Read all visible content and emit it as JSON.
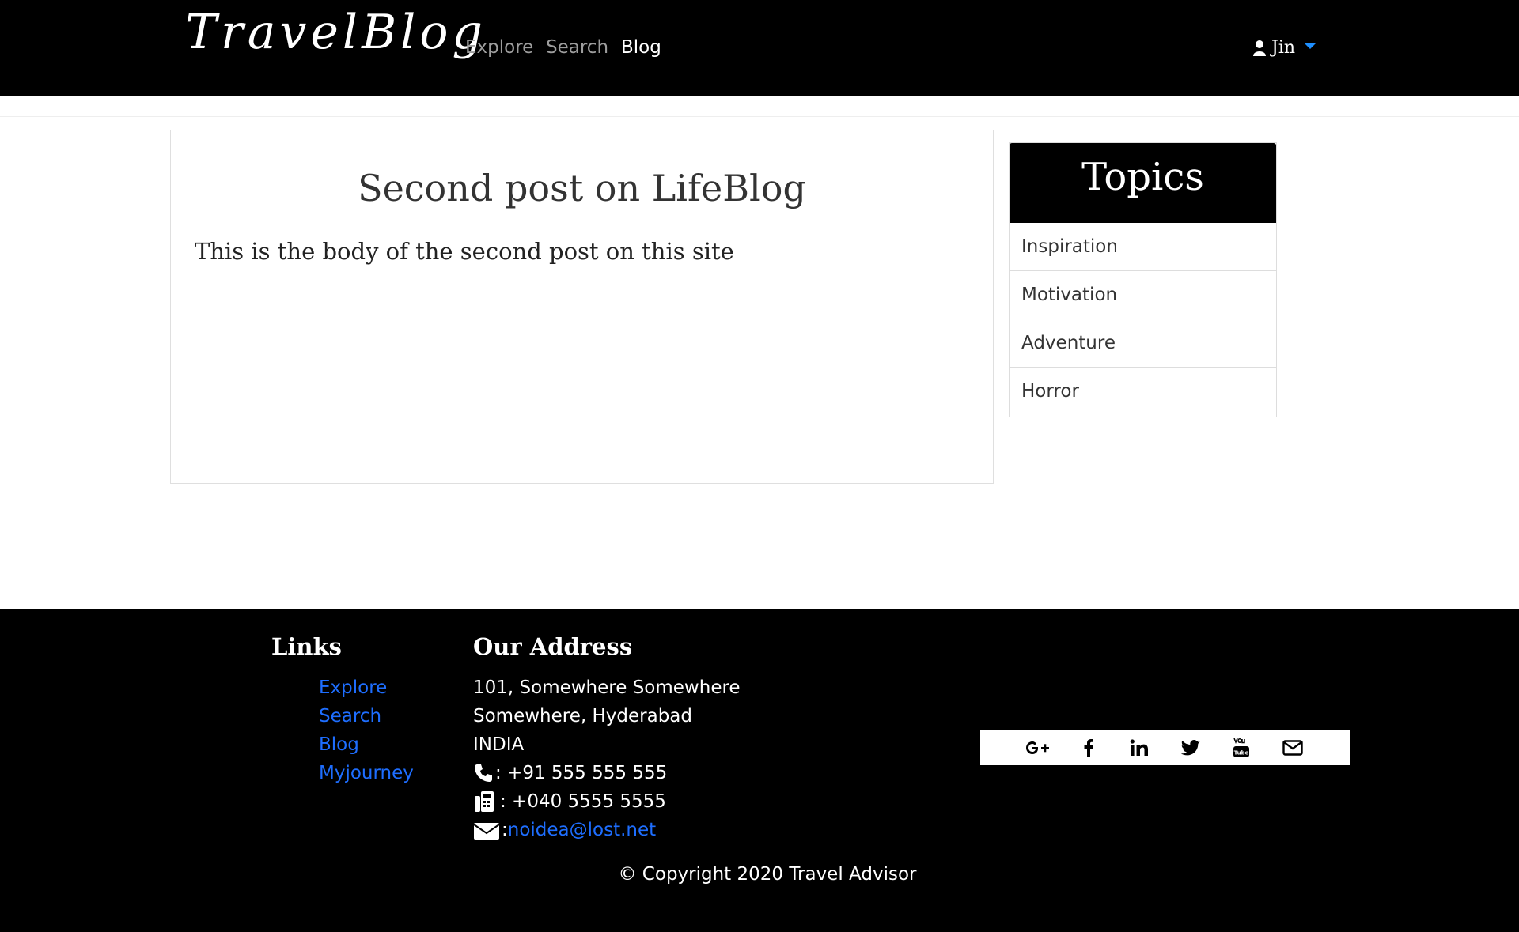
{
  "navbar": {
    "brand": "TravelBlog",
    "links": [
      "Explore",
      "Search",
      "Blog"
    ],
    "active": "Blog",
    "user_name": "Jin"
  },
  "post": {
    "title": "Second post on LifeBlog",
    "body": "This is the body of the second post on this site"
  },
  "topics": {
    "heading": "Topics",
    "items": [
      "Inspiration",
      "Motivation",
      "Adventure",
      "Horror"
    ]
  },
  "footer": {
    "links_title": "Links",
    "links": [
      "Explore",
      "Search",
      "Blog",
      "Myjourney"
    ],
    "address_title": "Our Address",
    "address_lines": [
      "101, Somewhere Somewhere",
      "Somewhere, Hyderabad",
      "INDIA"
    ],
    "phone": ": +91 555 555 555",
    "fax": ": +040 5555 5555",
    "email_prefix": ": ",
    "email": "noidea@lost.net",
    "social_icons": [
      "google-plus-icon",
      "facebook-icon",
      "linkedin-icon",
      "twitter-icon",
      "youtube-icon",
      "mail-icon"
    ],
    "copyright": "© Copyright 2020 Travel Advisor"
  },
  "colors": {
    "navbar_bg": "#000000",
    "link_blue": "#1e6eff",
    "caret_blue": "#1e8fff",
    "inactive_nav": "#9d9d9d"
  }
}
